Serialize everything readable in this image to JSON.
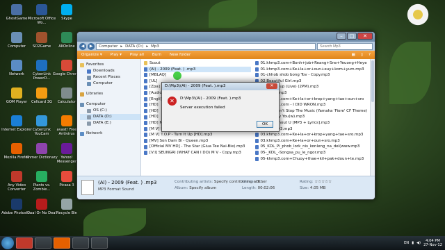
{
  "desktop": {
    "icons": [
      {
        "label": "GhostGame",
        "color": "#4a6fa5"
      },
      {
        "label": "Microsoft Office Wo...",
        "color": "#2b5797"
      },
      {
        "label": "Skype",
        "color": "#00aff0"
      },
      {
        "label": "Computer",
        "color": "#6a8fb5"
      },
      {
        "label": "SO2Game",
        "color": "#a0522d"
      },
      {
        "label": "AKOnline",
        "color": "#2e8b57"
      },
      {
        "label": "Network",
        "color": "#5b8cc4"
      },
      {
        "label": "CyberLink PowerD...",
        "color": "#1e6fbf"
      },
      {
        "label": "Google Chrome",
        "color": "#d94a38"
      },
      {
        "label": "GOM Player",
        "color": "#e0b020"
      },
      {
        "label": "Cellcard 3G",
        "color": "#f39c12"
      },
      {
        "label": "Calculator",
        "color": "#7f8c8d"
      },
      {
        "label": "Internet Explorer",
        "color": "#1b7fd6"
      },
      {
        "label": "CyberLink YouCam",
        "color": "#3498db"
      },
      {
        "label": "avast! Free Antivirus",
        "color": "#f57c00"
      },
      {
        "label": "Mozilla Firefox",
        "color": "#e66000"
      },
      {
        "label": "Khmer Dictionary",
        "color": "#8e44ad"
      },
      {
        "label": "Yahoo! Messenger",
        "color": "#6a1b9a"
      },
      {
        "label": "Any Video Converter",
        "color": "#c0392b"
      },
      {
        "label": "Plants vs. Zombie...",
        "color": "#27ae60"
      },
      {
        "label": "Picasa 3",
        "color": "#e74c3c"
      },
      {
        "label": "Adobe Photosh...",
        "color": "#1a3a6b"
      },
      {
        "label": "Deal Or No Deal",
        "color": "#b71c1c"
      },
      {
        "label": "Recycle Bin",
        "color": "#95a5a6"
      }
    ]
  },
  "explorer": {
    "address": [
      "Computer",
      "DATA (D:)",
      "Mp3"
    ],
    "search_placeholder": "Search Mp3",
    "toolbar": [
      "Organize ▾",
      "Play ▾",
      "Play all",
      "Burn",
      "New folder"
    ],
    "nav": {
      "favorites": "Favorites",
      "favorites_items": [
        "Downloads",
        "Recent Places",
        "Computer"
      ],
      "libraries": "Libraries",
      "computer": "Computer",
      "drives": [
        "OS (C:)",
        "DATA (D:)",
        "DATA (E:)"
      ],
      "network": "Network"
    },
    "files_left": [
      "Scout",
      "(Al) - 2009 (Feat. ) .mp3",
      "[MBLAQ]",
      "[UL]",
      "[Zpa]",
      "[Audio]",
      "[Engli]",
      "[HD]",
      "[HD]",
      "[HD]",
      "[HD] M",
      "[M V] Fo to Seoul Boom Boom Boom.mp3",
      "[M V] T.O.P - Turn It Up [HD].mp3",
      "[MV] Son Dam Bi - Queen.mp3",
      "[Official MV HD]                - The Star (Giua Tee Nai-Bie).mp3",
      "[V:I] SEUNGRI       (WHAT CAN I DO) M V - Copy.mp3"
    ],
    "files_right": [
      "01.khmp3.com+Bonh+job+Reang+Sne+Yeuong+Heye",
      "01.khmp3.com+Ke+la+or+oun+euy+kom+yum.mp3",
      "01-chhob shob bong Tov - Copy.mp3",
      "02 Beautiful Girl.mp3",
      "02 Hands up (Live) (2PM).mp3",
      "02 Lupin.mp3",
      "02.khmp3.com+Ke+la+or+krop+yang+tae+oun+sro",
      "02.khmp3.com - I DID WRON.mp3",
      "2NE1 - Don't Stop The Music (Yamaha 'Fiore' CF Theme)",
      "2PM - Only You(w).mp3",
      "2PM - Without U [MP3 + Lyrics].mp3",
      "03 Track 03.mp3",
      "03.khmp3.com+Ke+la+or+krop+yang+tae+sro.mp3",
      "03.khmp3.com+Ke+la+or+oun+sro.mp3",
      "05_KDL_Pi_phob_lork_nis_konleng_na_del(www.mp3",
      "05-_KDL_-Songsa_pu_le_ngor.mp3",
      "05-khmp3.com+Chuoy+thae+kil+pak+doun+te.mp3"
    ],
    "details": {
      "name": "(Al) - 2009 (Feat.   ) .mp3",
      "type": "MP3 Format Sound",
      "contrib_label": "Contributing artists:",
      "contrib_value": "Specify contributing art...",
      "album_label": "Album:",
      "album_value": "Specify album",
      "genre_label": "Genre:",
      "genre_value": "Other",
      "length_label": "Length:",
      "length_value": "00:02:06",
      "rating_label": "Rating:",
      "rating_value": "☆☆☆☆☆",
      "size_label": "Size:",
      "size_value": "4.05 MB"
    }
  },
  "dialog": {
    "title": "D:\\Mp3\\(Al) - 2009 (Feat.   ).mp3",
    "path": "D:\\Mp3\\(Al) - 2009 (Feat.   ).mp3",
    "message": "Server execution failed",
    "ok": "OK",
    "close": "✕"
  },
  "taskbar": {
    "lang": "EN",
    "time": "4:04 PM",
    "date": "27-Nov-12"
  },
  "colors": {
    "accent_toolbar": "#e0861b",
    "error": "#cc2222",
    "selection": "#cfe5f9"
  }
}
